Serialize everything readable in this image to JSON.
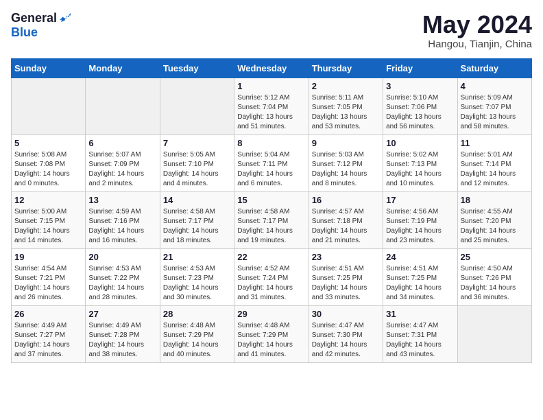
{
  "header": {
    "logo_general": "General",
    "logo_blue": "Blue",
    "month_title": "May 2024",
    "location": "Hangou, Tianjin, China"
  },
  "weekdays": [
    "Sunday",
    "Monday",
    "Tuesday",
    "Wednesday",
    "Thursday",
    "Friday",
    "Saturday"
  ],
  "weeks": [
    [
      {
        "day": "",
        "sunrise": "",
        "sunset": "",
        "daylight": ""
      },
      {
        "day": "",
        "sunrise": "",
        "sunset": "",
        "daylight": ""
      },
      {
        "day": "",
        "sunrise": "",
        "sunset": "",
        "daylight": ""
      },
      {
        "day": "1",
        "sunrise": "Sunrise: 5:12 AM",
        "sunset": "Sunset: 7:04 PM",
        "daylight": "Daylight: 13 hours and 51 minutes."
      },
      {
        "day": "2",
        "sunrise": "Sunrise: 5:11 AM",
        "sunset": "Sunset: 7:05 PM",
        "daylight": "Daylight: 13 hours and 53 minutes."
      },
      {
        "day": "3",
        "sunrise": "Sunrise: 5:10 AM",
        "sunset": "Sunset: 7:06 PM",
        "daylight": "Daylight: 13 hours and 56 minutes."
      },
      {
        "day": "4",
        "sunrise": "Sunrise: 5:09 AM",
        "sunset": "Sunset: 7:07 PM",
        "daylight": "Daylight: 13 hours and 58 minutes."
      }
    ],
    [
      {
        "day": "5",
        "sunrise": "Sunrise: 5:08 AM",
        "sunset": "Sunset: 7:08 PM",
        "daylight": "Daylight: 14 hours and 0 minutes."
      },
      {
        "day": "6",
        "sunrise": "Sunrise: 5:07 AM",
        "sunset": "Sunset: 7:09 PM",
        "daylight": "Daylight: 14 hours and 2 minutes."
      },
      {
        "day": "7",
        "sunrise": "Sunrise: 5:05 AM",
        "sunset": "Sunset: 7:10 PM",
        "daylight": "Daylight: 14 hours and 4 minutes."
      },
      {
        "day": "8",
        "sunrise": "Sunrise: 5:04 AM",
        "sunset": "Sunset: 7:11 PM",
        "daylight": "Daylight: 14 hours and 6 minutes."
      },
      {
        "day": "9",
        "sunrise": "Sunrise: 5:03 AM",
        "sunset": "Sunset: 7:12 PM",
        "daylight": "Daylight: 14 hours and 8 minutes."
      },
      {
        "day": "10",
        "sunrise": "Sunrise: 5:02 AM",
        "sunset": "Sunset: 7:13 PM",
        "daylight": "Daylight: 14 hours and 10 minutes."
      },
      {
        "day": "11",
        "sunrise": "Sunrise: 5:01 AM",
        "sunset": "Sunset: 7:14 PM",
        "daylight": "Daylight: 14 hours and 12 minutes."
      }
    ],
    [
      {
        "day": "12",
        "sunrise": "Sunrise: 5:00 AM",
        "sunset": "Sunset: 7:15 PM",
        "daylight": "Daylight: 14 hours and 14 minutes."
      },
      {
        "day": "13",
        "sunrise": "Sunrise: 4:59 AM",
        "sunset": "Sunset: 7:16 PM",
        "daylight": "Daylight: 14 hours and 16 minutes."
      },
      {
        "day": "14",
        "sunrise": "Sunrise: 4:58 AM",
        "sunset": "Sunset: 7:17 PM",
        "daylight": "Daylight: 14 hours and 18 minutes."
      },
      {
        "day": "15",
        "sunrise": "Sunrise: 4:58 AM",
        "sunset": "Sunset: 7:17 PM",
        "daylight": "Daylight: 14 hours and 19 minutes."
      },
      {
        "day": "16",
        "sunrise": "Sunrise: 4:57 AM",
        "sunset": "Sunset: 7:18 PM",
        "daylight": "Daylight: 14 hours and 21 minutes."
      },
      {
        "day": "17",
        "sunrise": "Sunrise: 4:56 AM",
        "sunset": "Sunset: 7:19 PM",
        "daylight": "Daylight: 14 hours and 23 minutes."
      },
      {
        "day": "18",
        "sunrise": "Sunrise: 4:55 AM",
        "sunset": "Sunset: 7:20 PM",
        "daylight": "Daylight: 14 hours and 25 minutes."
      }
    ],
    [
      {
        "day": "19",
        "sunrise": "Sunrise: 4:54 AM",
        "sunset": "Sunset: 7:21 PM",
        "daylight": "Daylight: 14 hours and 26 minutes."
      },
      {
        "day": "20",
        "sunrise": "Sunrise: 4:53 AM",
        "sunset": "Sunset: 7:22 PM",
        "daylight": "Daylight: 14 hours and 28 minutes."
      },
      {
        "day": "21",
        "sunrise": "Sunrise: 4:53 AM",
        "sunset": "Sunset: 7:23 PM",
        "daylight": "Daylight: 14 hours and 30 minutes."
      },
      {
        "day": "22",
        "sunrise": "Sunrise: 4:52 AM",
        "sunset": "Sunset: 7:24 PM",
        "daylight": "Daylight: 14 hours and 31 minutes."
      },
      {
        "day": "23",
        "sunrise": "Sunrise: 4:51 AM",
        "sunset": "Sunset: 7:25 PM",
        "daylight": "Daylight: 14 hours and 33 minutes."
      },
      {
        "day": "24",
        "sunrise": "Sunrise: 4:51 AM",
        "sunset": "Sunset: 7:25 PM",
        "daylight": "Daylight: 14 hours and 34 minutes."
      },
      {
        "day": "25",
        "sunrise": "Sunrise: 4:50 AM",
        "sunset": "Sunset: 7:26 PM",
        "daylight": "Daylight: 14 hours and 36 minutes."
      }
    ],
    [
      {
        "day": "26",
        "sunrise": "Sunrise: 4:49 AM",
        "sunset": "Sunset: 7:27 PM",
        "daylight": "Daylight: 14 hours and 37 minutes."
      },
      {
        "day": "27",
        "sunrise": "Sunrise: 4:49 AM",
        "sunset": "Sunset: 7:28 PM",
        "daylight": "Daylight: 14 hours and 38 minutes."
      },
      {
        "day": "28",
        "sunrise": "Sunrise: 4:48 AM",
        "sunset": "Sunset: 7:29 PM",
        "daylight": "Daylight: 14 hours and 40 minutes."
      },
      {
        "day": "29",
        "sunrise": "Sunrise: 4:48 AM",
        "sunset": "Sunset: 7:29 PM",
        "daylight": "Daylight: 14 hours and 41 minutes."
      },
      {
        "day": "30",
        "sunrise": "Sunrise: 4:47 AM",
        "sunset": "Sunset: 7:30 PM",
        "daylight": "Daylight: 14 hours and 42 minutes."
      },
      {
        "day": "31",
        "sunrise": "Sunrise: 4:47 AM",
        "sunset": "Sunset: 7:31 PM",
        "daylight": "Daylight: 14 hours and 43 minutes."
      },
      {
        "day": "",
        "sunrise": "",
        "sunset": "",
        "daylight": ""
      }
    ]
  ]
}
